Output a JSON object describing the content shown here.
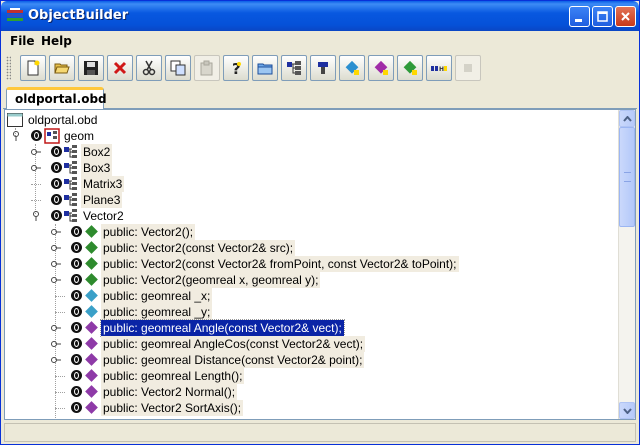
{
  "window": {
    "title": "ObjectBuilder"
  },
  "menu": {
    "file": "File",
    "help": "Help"
  },
  "toolbar": {
    "buttons": [
      {
        "icon": "new-document-icon"
      },
      {
        "icon": "open-folder-icon"
      },
      {
        "icon": "save-icon"
      },
      {
        "icon": "delete-icon"
      },
      {
        "icon": "cut-icon"
      },
      {
        "icon": "copy-icon"
      },
      {
        "icon": "paste-icon",
        "disabled": true
      },
      {
        "icon": "help-icon"
      },
      {
        "icon": "open-project-icon"
      },
      {
        "icon": "add-class-icon"
      },
      {
        "icon": "add-namespace-icon"
      },
      {
        "icon": "add-method-icon"
      },
      {
        "icon": "add-attribute-icon"
      },
      {
        "icon": "add-property-icon"
      },
      {
        "icon": "generate-code-icon"
      },
      {
        "icon": "disabled-action-icon",
        "disabled": true
      }
    ]
  },
  "tabs": [
    {
      "label": "oldportal.obd"
    }
  ],
  "tree": {
    "root": "oldportal.obd",
    "namespace": "geom",
    "classes": [
      "Box2",
      "Box3",
      "Matrix3",
      "Plane3",
      "Vector2"
    ],
    "members": [
      "public: Vector2();",
      "public: Vector2(const Vector2& src);",
      "public: Vector2(const Vector2& fromPoint, const Vector2& toPoint);",
      "public: Vector2(geomreal x, geomreal y);",
      "public: geomreal _x;",
      "public: geomreal _y;",
      "public: geomreal Angle(const Vector2& vect);",
      "public: geomreal AngleCos(const Vector2& vect);",
      "public: geomreal Distance(const Vector2& point);",
      "public: geomreal Length();",
      "public: Vector2 Normal();",
      "public: Vector2 SortAxis();"
    ],
    "selected_member": "public: geomreal Angle(const Vector2& vect);"
  },
  "colors": {
    "title_bar": "#0858e0",
    "selection": "#0a24a6",
    "tab_accent": "#ffc83c",
    "constructor_icon": "#2e8b2e",
    "attribute_icon": "#3aa0c8",
    "method_icon": "#8e3aa8"
  }
}
